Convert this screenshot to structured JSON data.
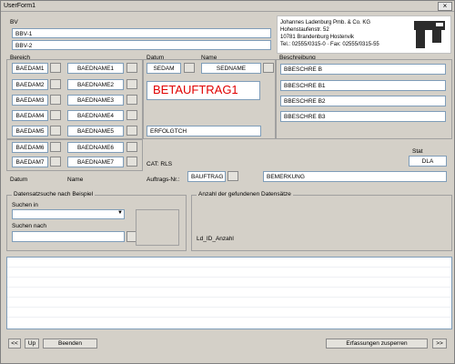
{
  "window": {
    "title": "UserForm1",
    "close_label": "×"
  },
  "top": {
    "label": "BV",
    "bv1": "BBV-1",
    "bv2": "BBV-2"
  },
  "company": {
    "lines": [
      "Johannes Ladenburg Pmb. & Co. KG",
      "Hohenstaufenstr. 52",
      "10781 Brandenburg Hostenvik",
      "Tel.: 02555/0315-0 · Fax: 02555/0315-55"
    ]
  },
  "headers": {
    "bereich": "Bereich",
    "datum": "Datum",
    "name": "Name",
    "beschreibung": "Beschreibung"
  },
  "bereich_rows": [
    {
      "code": "BAEDAM1",
      "name": "BAEDNAME1"
    },
    {
      "code": "BAEDAM2",
      "name": "BAEDNAME2"
    },
    {
      "code": "BAEDAM3",
      "name": "BAEDNAME3"
    },
    {
      "code": "BAEDAM4",
      "name": "BAEDNAME4"
    },
    {
      "code": "BAEDAM5",
      "name": "BAEDNAME5"
    },
    {
      "code": "BAEDAM6",
      "name": "BAEDNAME6"
    },
    {
      "code": "BAEDAM7",
      "name": "BAEDNAME7"
    }
  ],
  "datum_value": "SEDAM",
  "name_value": "SEDNAME",
  "big_label": "BETAUFTRAG1",
  "erfolgt_value": "ERFOLGTCH",
  "beschreibung_rows": [
    "BBESCHRE B",
    "BBESCHRE B1",
    "BBESCHRE B2",
    "BBESCHRE B3"
  ],
  "status": {
    "label": "Stat",
    "value": "DLA"
  },
  "cat": {
    "label": "CAT: RLS"
  },
  "bottom_row": {
    "datum_label": "Datum",
    "name_label": "Name",
    "auftrag_label": "Auftrags-Nr.:",
    "auftrag_value": "BAUFTRAG",
    "bemerkung_value": "BEMERKUNG"
  },
  "search": {
    "title": "Datensatzsuche nach Beispiel",
    "in_label": "Suchen in",
    "nach_label": "Suchen nach"
  },
  "count": {
    "title": "Anzahl der gefundenen Datensätze",
    "value": "Ld_ID_Anzahl"
  },
  "footer": {
    "prev": "<<",
    "up": "Up",
    "beenden": "Beenden",
    "send": "Erfassungen zusperren",
    "last": ">>"
  }
}
